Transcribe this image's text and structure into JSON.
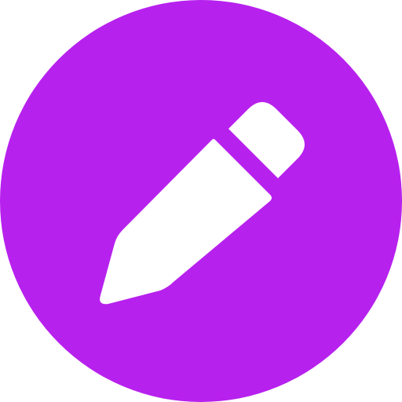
{
  "icon": {
    "name": "pencil-edit-icon",
    "background_color": "#B721EE",
    "glyph_color": "#FFFFFF"
  }
}
